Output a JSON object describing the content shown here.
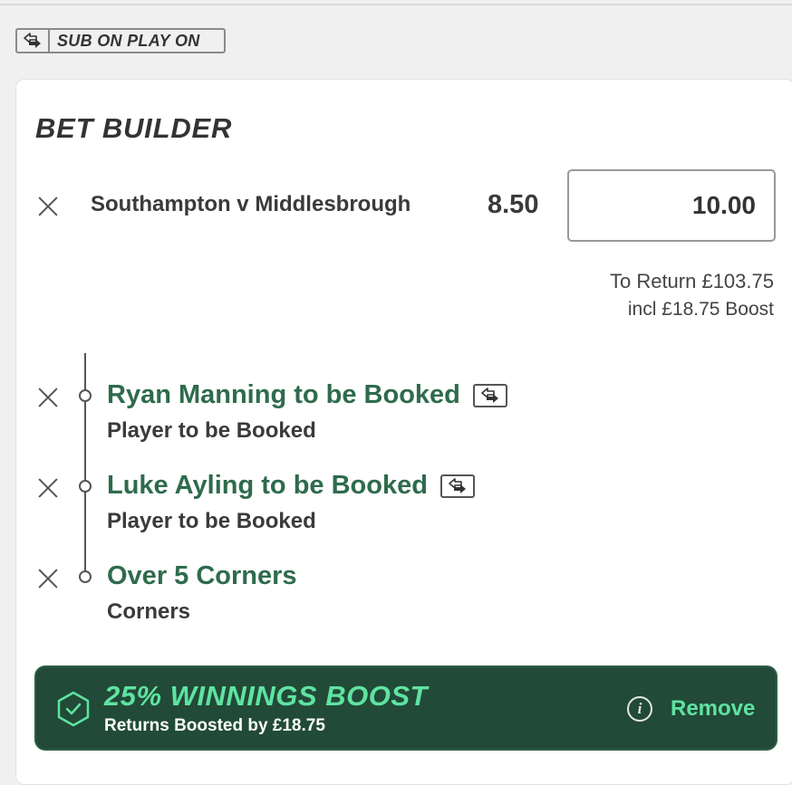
{
  "badge": {
    "label": "SUB ON PLAY ON",
    "icon": "substitute-icon"
  },
  "bet_builder": {
    "title": "BET BUILDER",
    "match": "Southampton v Middlesbrough",
    "odds": "8.50",
    "stake": "10.00",
    "to_return": "To Return £103.75",
    "incl_boost": "incl £18.75 Boost",
    "selections": [
      {
        "title": "Ryan Manning to be Booked",
        "market": "Player to be Booked",
        "sub_icon": true
      },
      {
        "title": "Luke Ayling to be Booked",
        "market": "Player to be Booked",
        "sub_icon": true
      },
      {
        "title": "Over 5 Corners",
        "market": "Corners",
        "sub_icon": false
      }
    ]
  },
  "boost": {
    "title": "25% WINNINGS BOOST",
    "subtitle": "Returns Boosted by £18.75",
    "info_icon": "i",
    "remove_label": "Remove"
  },
  "colors": {
    "selection_green": "#2e6b4c",
    "boost_bg": "#214a38",
    "boost_accent": "#5fe3a1"
  }
}
